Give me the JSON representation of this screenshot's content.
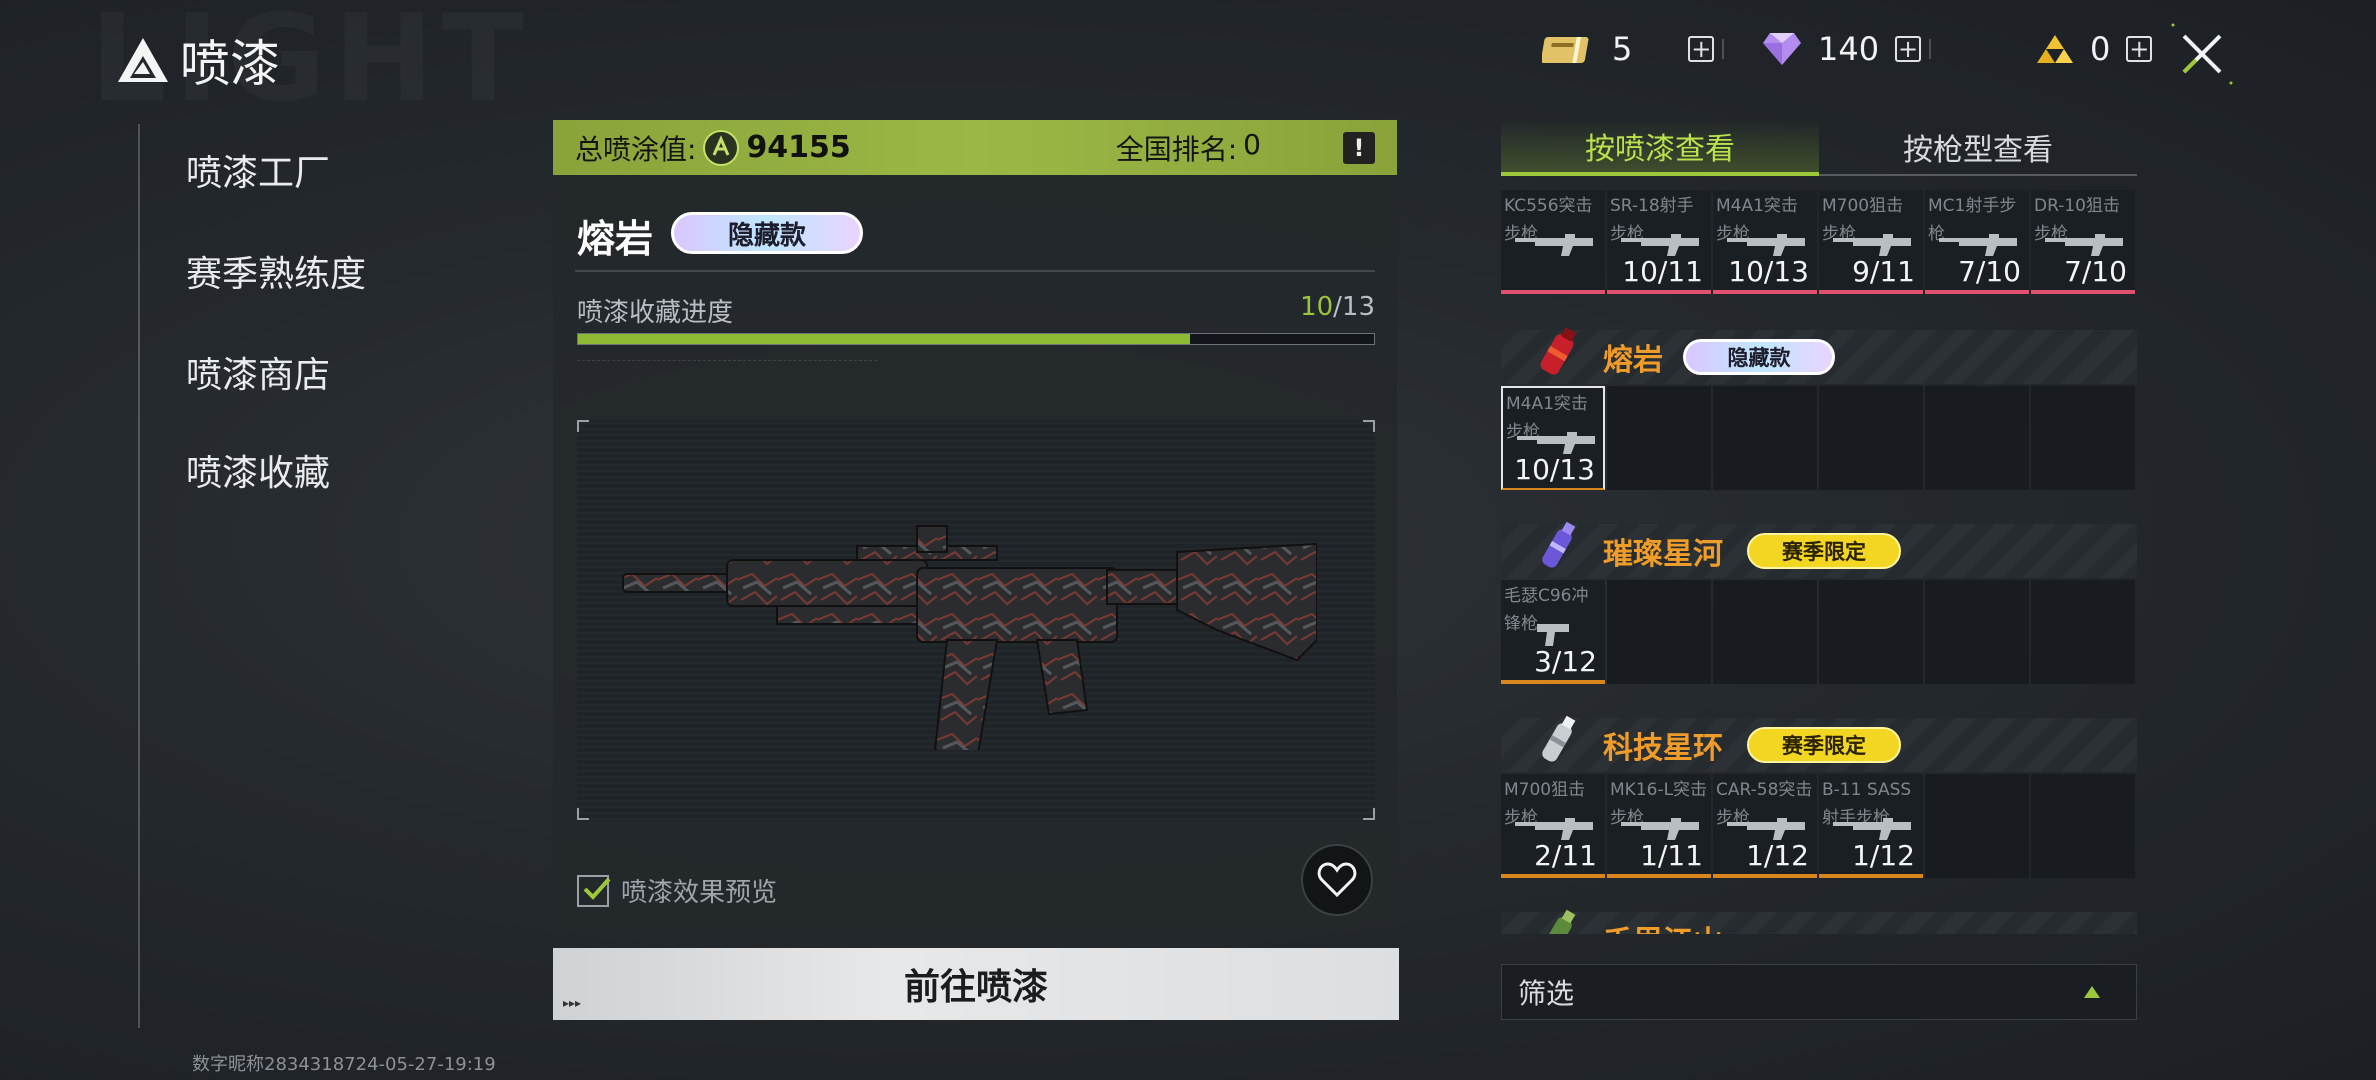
{
  "header": {
    "title": "喷漆",
    "currencies": [
      {
        "icon": "ticket-icon",
        "value": "5"
      },
      {
        "icon": "diamond-icon",
        "value": "140"
      },
      {
        "icon": "gold-icon",
        "value": "0"
      }
    ]
  },
  "sidebar": {
    "items": [
      {
        "label": "喷漆工厂"
      },
      {
        "label": "赛季熟练度"
      },
      {
        "label": "喷漆商店"
      },
      {
        "label": "喷漆收藏"
      }
    ]
  },
  "footer": {
    "user_id": "数字昵称2834318724-05-27-19:19"
  },
  "center": {
    "score_label": "总喷涂值:",
    "score_value": "94155",
    "rank_label": "全国排名:",
    "rank_value": "0",
    "info_label": "!",
    "skin_name": "熔岩",
    "skin_badge": "隐藏款",
    "progress_label": "喷漆收藏进度",
    "progress_current": "10",
    "progress_total": "/13",
    "progress_fraction": 0.7692,
    "preview_label": "喷漆效果预览",
    "preview_checked": true,
    "goto_label": "前往喷漆"
  },
  "right": {
    "tabs": [
      {
        "label": "按喷漆查看",
        "active": true
      },
      {
        "label": "按枪型查看",
        "active": false
      }
    ],
    "top_row": [
      {
        "name": "KC556突击步枪",
        "count": ""
      },
      {
        "name": "SR-18射手步枪",
        "count": "10/11"
      },
      {
        "name": "M4A1突击步枪",
        "count": "10/13"
      },
      {
        "name": "M700狙击步枪",
        "count": "9/11"
      },
      {
        "name": "MC1射手步枪",
        "count": "7/10"
      },
      {
        "name": "DR-10狙击步枪",
        "count": "7/10"
      }
    ],
    "groups": [
      {
        "name": "熔岩",
        "tag": "隐藏款",
        "tag_type": "hidden",
        "items": [
          {
            "name": "M4A1突击步枪",
            "count": "10/13"
          }
        ]
      },
      {
        "name": "璀璨星河",
        "tag": "赛季限定",
        "tag_type": "season",
        "items": [
          {
            "name": "毛瑟C96冲锋枪",
            "count": "3/12"
          }
        ]
      },
      {
        "name": "科技星环",
        "tag": "赛季限定",
        "tag_type": "season",
        "items": [
          {
            "name": "M700狙击步枪",
            "count": "2/11"
          },
          {
            "name": "MK16-L突击步枪",
            "count": "1/11"
          },
          {
            "name": "CAR-58突击步枪",
            "count": "1/12"
          },
          {
            "name": "B-11 SASS射手步枪",
            "count": "1/12"
          }
        ]
      },
      {
        "name": "千里江山",
        "tag": "",
        "tag_type": "",
        "items": []
      }
    ],
    "filter_label": "筛选"
  },
  "colors": {
    "accent_green": "#9cc93a",
    "orange_name": "#f09c2a",
    "season_tag": "#f2d622",
    "pink_bar": "#e2506f"
  }
}
